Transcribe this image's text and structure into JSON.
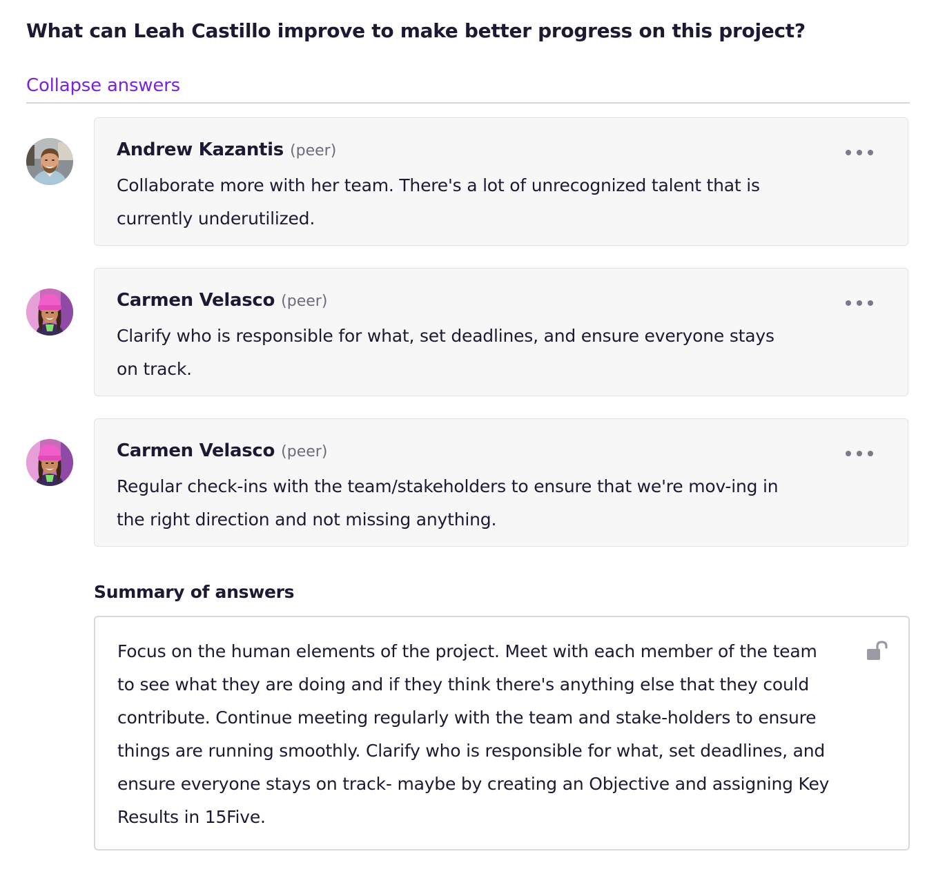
{
  "question": {
    "title": "What can Leah Castillo improve to make better progress on this project?"
  },
  "collapse_link": {
    "label": "Collapse answers"
  },
  "answers": [
    {
      "author": "Andrew Kazantis",
      "role": "(peer)",
      "text": "Collaborate more with her team. There's a lot of unrecognized talent that is currently underutilized.",
      "avatar_icon": "avatar-man-beard"
    },
    {
      "author": "Carmen Velasco",
      "role": "(peer)",
      "text": "Clarify who is responsible for what, set deadlines, and ensure everyone stays on track.",
      "avatar_icon": "avatar-woman-pink-hat"
    },
    {
      "author": "Carmen Velasco",
      "role": "(peer)",
      "text": "Regular check-ins with the team/stakeholders to ensure that we're mov-ing in the right direction and not missing anything.",
      "avatar_icon": "avatar-woman-pink-hat"
    }
  ],
  "summary": {
    "label": "Summary of answers",
    "text": "Focus on the human elements of the project. Meet with each member of the team to see what they are doing and if they think there's anything else that they could contribute. Continue meeting regularly with the team and stake-holders to ensure things are running smoothly. Clarify who is responsible for what, set deadlines, and ensure everyone stays on track- maybe by creating an Objective and assigning Key Results in 15Five.",
    "lock_icon": "unlocked-padlock-icon"
  },
  "colors": {
    "accent": "#7c22dd",
    "text": "#1d1933",
    "card_bg": "#f7f7f8",
    "muted": "#6b6b7b"
  }
}
